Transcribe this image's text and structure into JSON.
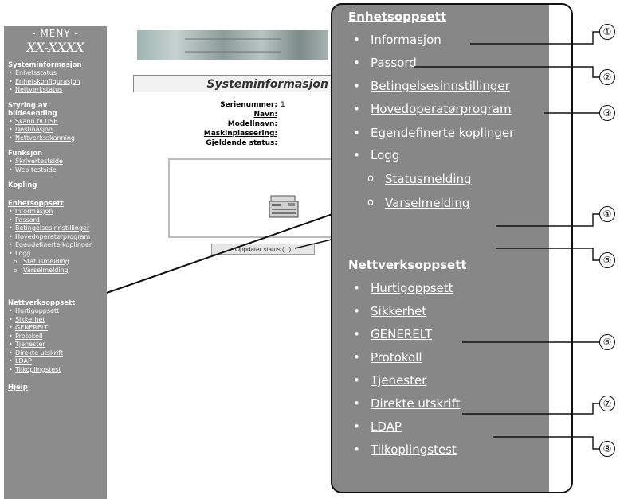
{
  "sidebar": {
    "menu_title": "- MENY -",
    "model": "XX-XXXX",
    "sections": {
      "system": {
        "title": "Systeminformasjon",
        "items": [
          "Enhetsstatus",
          "Enhetskonfigurasjon",
          "Nettverkstatus"
        ]
      },
      "scan": {
        "title": "Styring av bildesending",
        "items": [
          "Skann til USB",
          "Destinasjon",
          "Nettverksskanning"
        ]
      },
      "function": {
        "title": "Funksjon",
        "items": [
          "Skrivertestside",
          "Web testside"
        ]
      },
      "link": {
        "title": "Kopling"
      },
      "device": {
        "title": "Enhetsoppsett",
        "items": [
          "Informasjon",
          "Passord",
          "Betingelsesinnstillinger",
          "Hovedoperatørprogram",
          "Egendefinerte koplinger",
          "Logg"
        ],
        "subitems": [
          "Statusmelding",
          "Varselmelding"
        ]
      },
      "network": {
        "title": "Nettverksoppsett",
        "items": [
          "Hurtigoppsett",
          "Sikkerhet",
          "GENERELT",
          "Protokoll",
          "Tjenester",
          "Direkte utskrift",
          "LDAP",
          "Tilkoplingstest"
        ]
      },
      "help": {
        "title": "Hjelp"
      }
    }
  },
  "main": {
    "page_title": "Systeminformasjon",
    "info": [
      {
        "label": "Serienummer:",
        "value": "1",
        "link": false
      },
      {
        "label": "Navn:",
        "value": "",
        "link": true
      },
      {
        "label": "Modellnavn:",
        "value": "",
        "link": false
      },
      {
        "label": "Maskinplassering:",
        "value": "",
        "link": true
      },
      {
        "label": "Gjeldende status:",
        "value": "",
        "link": false
      }
    ],
    "update_button": "Oppdater status (U)"
  },
  "zoom": {
    "device_title": "Enhetsoppsett",
    "device_items": [
      "Informasjon",
      "Passord",
      "Betingelsesinnstillinger",
      "Hovedoperatørprogram",
      "Egendefinerte koplinger",
      "Logg"
    ],
    "log_items": [
      "Statusmelding",
      "Varselmelding"
    ],
    "network_title": "Nettverksoppsett",
    "network_items": [
      "Hurtigoppsett",
      "Sikkerhet",
      "GENERELT",
      "Protokoll",
      "Tjenester",
      "Direkte utskrift",
      "LDAP",
      "Tilkoplingstest"
    ]
  },
  "callouts": [
    "①",
    "②",
    "③",
    "④",
    "⑤",
    "⑥",
    "⑦",
    "⑧"
  ]
}
